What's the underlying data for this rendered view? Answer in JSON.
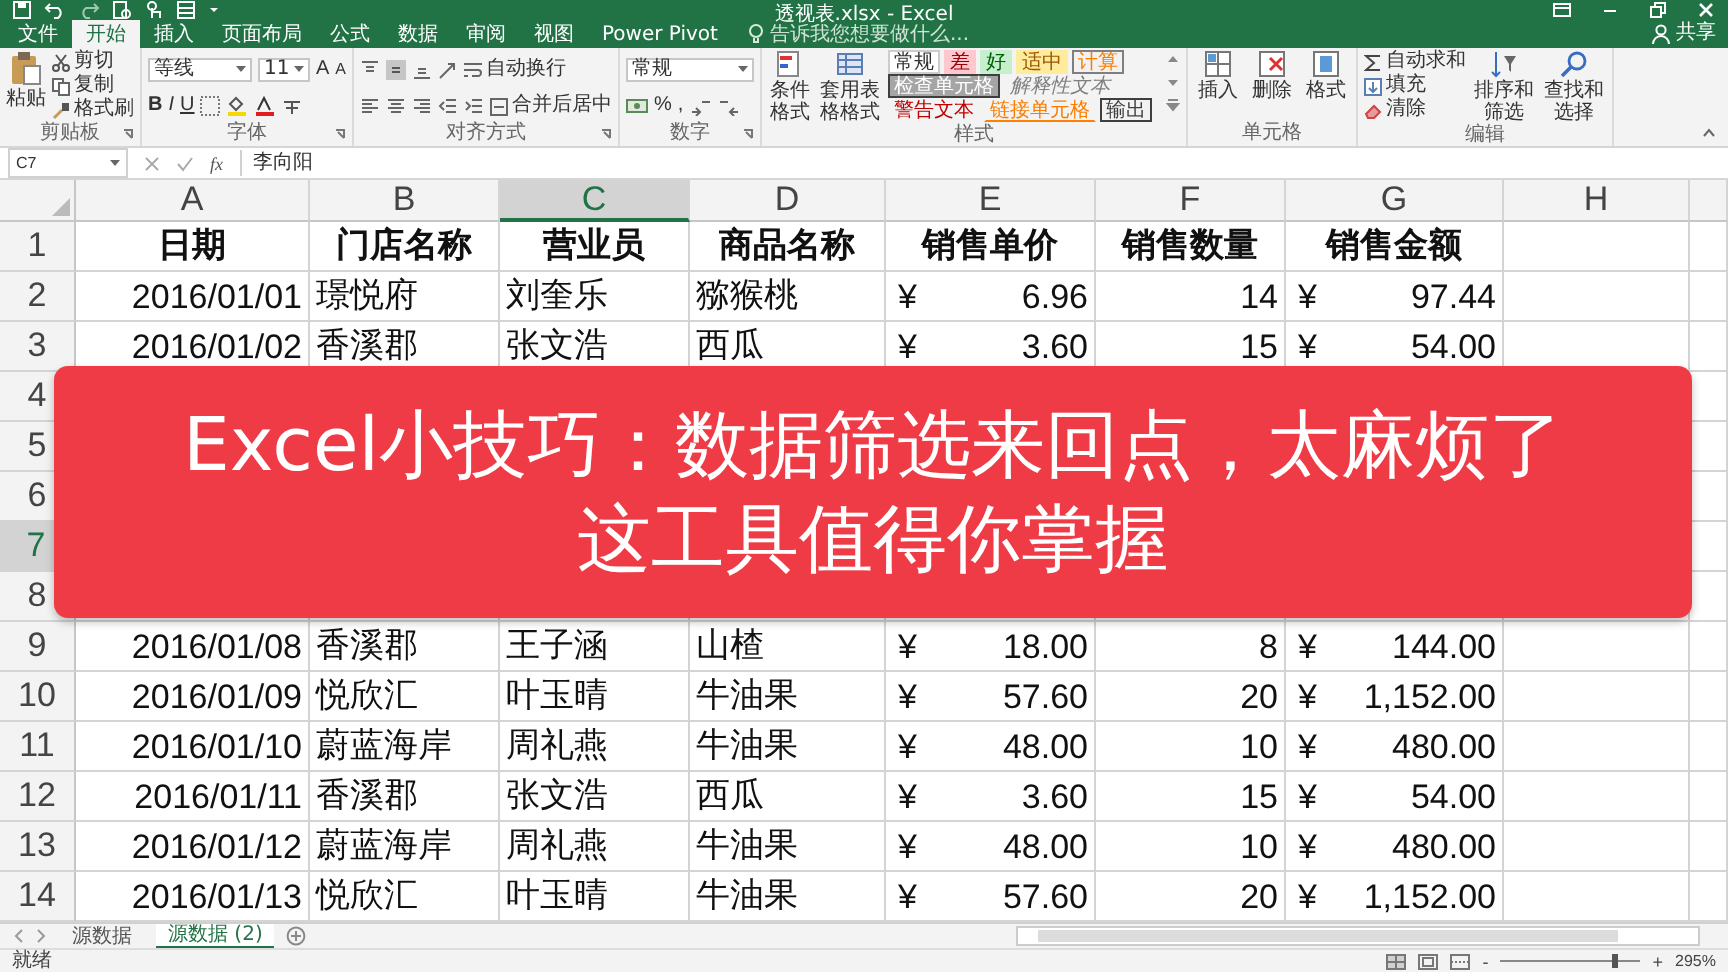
{
  "window": {
    "title": "透视表.xlsx - Excel"
  },
  "tabs": [
    {
      "label": "文件",
      "selected": false
    },
    {
      "label": "开始",
      "selected": true
    },
    {
      "label": "插入",
      "selected": false
    },
    {
      "label": "页面布局",
      "selected": false
    },
    {
      "label": "公式",
      "selected": false
    },
    {
      "label": "数据",
      "selected": false
    },
    {
      "label": "审阅",
      "selected": false
    },
    {
      "label": "视图",
      "selected": false
    },
    {
      "label": "Power Pivot",
      "selected": false
    }
  ],
  "tell_me": {
    "placeholder": "告诉我您想要做什么..."
  },
  "share": "共享",
  "ribbon": {
    "clipboard": {
      "label": "剪贴板",
      "paste": "粘贴",
      "items": [
        "剪切",
        "复制",
        "格式刷"
      ]
    },
    "font": {
      "label": "字体",
      "font_name": "等线",
      "font_size": "11",
      "grow": "A",
      "shrink": "A",
      "bold": "B",
      "italic": "I",
      "underline": "U"
    },
    "alignment": {
      "label": "对齐方式",
      "wrap": "自动换行",
      "merge": "合并后居中"
    },
    "number": {
      "label": "数字",
      "format": "常规",
      "percent": "%",
      "comma": ","
    },
    "styles": {
      "label": "样式",
      "conditional": "条件格式",
      "table": "套用表格格式",
      "cells": [
        {
          "text": "常规",
          "kind": "normal"
        },
        {
          "text": "差",
          "kind": "bad"
        },
        {
          "text": "好",
          "kind": "good"
        },
        {
          "text": "适中",
          "kind": "neutral"
        },
        {
          "text": "计算",
          "kind": "calc"
        },
        {
          "text": "检查单元格",
          "kind": "check"
        },
        {
          "text": "解释性文本",
          "kind": "explanatory"
        },
        {
          "text": "警告文本",
          "kind": "warning"
        },
        {
          "text": "链接单元格",
          "kind": "linked"
        },
        {
          "text": "输出",
          "kind": "output"
        }
      ]
    },
    "cells": {
      "label": "单元格",
      "buttons": [
        "插入",
        "删除",
        "格式"
      ]
    },
    "editing": {
      "label": "编辑",
      "autosum": "自动求和",
      "fill": "填充",
      "clear": "清除",
      "sort": "排序和筛选",
      "find": "查找和选择"
    }
  },
  "formula_bar": {
    "name_box": "C7",
    "fx": "fx",
    "value": "李向阳"
  },
  "columns": [
    {
      "label": "A",
      "selected": false
    },
    {
      "label": "B",
      "selected": false
    },
    {
      "label": "C",
      "selected": true
    },
    {
      "label": "D",
      "selected": false
    },
    {
      "label": "E",
      "selected": false
    },
    {
      "label": "F",
      "selected": false
    },
    {
      "label": "G",
      "selected": false
    },
    {
      "label": "H",
      "selected": false
    }
  ],
  "rows": [
    {
      "num": "1",
      "selected": false,
      "kind": "header",
      "cells": [
        "日期",
        "门店名称",
        "营业员",
        "商品名称",
        "销售单价",
        "销售数量",
        "销售金额"
      ]
    },
    {
      "num": "2",
      "selected": false,
      "kind": "data",
      "cells": [
        "2016/01/01",
        "璟悦府",
        "刘奎乐",
        "猕猴桃",
        {
          "currency": "¥",
          "amount": "6.96"
        },
        "14",
        {
          "currency": "¥",
          "amount": "97.44"
        }
      ]
    },
    {
      "num": "3",
      "selected": false,
      "kind": "data",
      "cells": [
        "2016/01/02",
        "香溪郡",
        "张文浩",
        "西瓜",
        {
          "currency": "¥",
          "amount": "3.60"
        },
        "15",
        {
          "currency": "¥",
          "amount": "54.00"
        }
      ]
    },
    {
      "num": "4",
      "selected": false
    },
    {
      "num": "5",
      "selected": false
    },
    {
      "num": "6",
      "selected": false
    },
    {
      "num": "7",
      "selected": true
    },
    {
      "num": "8",
      "selected": false
    },
    {
      "num": "9",
      "selected": false,
      "kind": "data",
      "cells": [
        "2016/01/08",
        "香溪郡",
        "王子涵",
        "山楂",
        {
          "currency": "¥",
          "amount": "18.00"
        },
        "8",
        {
          "currency": "¥",
          "amount": "144.00"
        }
      ]
    },
    {
      "num": "10",
      "selected": false,
      "kind": "data",
      "cells": [
        "2016/01/09",
        "悦欣汇",
        "叶玉晴",
        "牛油果",
        {
          "currency": "¥",
          "amount": "57.60"
        },
        "20",
        {
          "currency": "¥",
          "amount": "1,152.00"
        }
      ]
    },
    {
      "num": "11",
      "selected": false,
      "kind": "data",
      "cells": [
        "2016/01/10",
        "蔚蓝海岸",
        "周礼燕",
        "牛油果",
        {
          "currency": "¥",
          "amount": "48.00"
        },
        "10",
        {
          "currency": "¥",
          "amount": "480.00"
        }
      ]
    },
    {
      "num": "12",
      "selected": false,
      "kind": "data",
      "cells": [
        "2016/01/11",
        "香溪郡",
        "张文浩",
        "西瓜",
        {
          "currency": "¥",
          "amount": "3.60"
        },
        "15",
        {
          "currency": "¥",
          "amount": "54.00"
        }
      ]
    },
    {
      "num": "13",
      "selected": false,
      "kind": "data",
      "cells": [
        "2016/01/12",
        "蔚蓝海岸",
        "周礼燕",
        "牛油果",
        {
          "currency": "¥",
          "amount": "48.00"
        },
        "10",
        {
          "currency": "¥",
          "amount": "480.00"
        }
      ]
    },
    {
      "num": "14",
      "selected": false,
      "kind": "data",
      "cells": [
        "2016/01/13",
        "悦欣汇",
        "叶玉晴",
        "牛油果",
        {
          "currency": "¥",
          "amount": "57.60"
        },
        "20",
        {
          "currency": "¥",
          "amount": "1,152.00"
        }
      ]
    }
  ],
  "banner": {
    "lines": [
      "Excel小技巧：数据筛选来回点，太麻烦了",
      "这工具值得你掌握"
    ]
  },
  "sheets": [
    {
      "name": "源数据",
      "selected": false
    },
    {
      "name": "源数据 (2)",
      "selected": true
    }
  ],
  "status": {
    "text": "就绪",
    "minus": "-",
    "plus": "+",
    "zoom": "295%",
    "zoom_slider": {
      "level": 0.8
    }
  }
}
